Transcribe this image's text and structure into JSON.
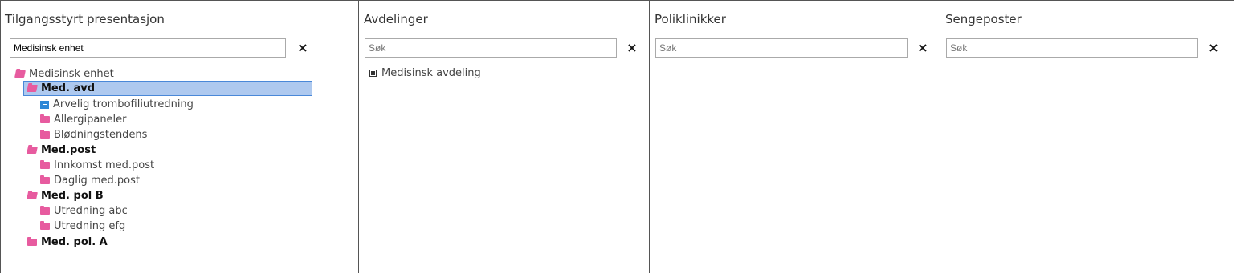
{
  "panel_main": {
    "title": "Tilgangsstyrt presentasjon",
    "search_value": "Medisinsk enhet",
    "clear": "×"
  },
  "tree": {
    "root": {
      "label": "Medisinsk enhet",
      "icon": "folder-open-icon"
    },
    "groups": [
      {
        "label": "Med. avd",
        "icon": "folder-open-icon",
        "selected": true
      },
      {
        "label": "Arvelig trombofiliutredning",
        "icon": "archive-icon"
      },
      {
        "label": "Allergipaneler",
        "icon": "folder-icon"
      },
      {
        "label": "Blødningstendens",
        "icon": "folder-icon"
      },
      {
        "label": "Med.post",
        "icon": "folder-open-icon"
      },
      {
        "label": "Innkomst med.post",
        "icon": "folder-icon"
      },
      {
        "label": "Daglig med.post",
        "icon": "folder-icon"
      },
      {
        "label": "Med. pol B",
        "icon": "folder-open-icon"
      },
      {
        "label": "Utredning abc",
        "icon": "folder-icon"
      },
      {
        "label": "Utredning efg",
        "icon": "folder-icon"
      },
      {
        "label": "Med. pol. A",
        "icon": "folder-icon"
      }
    ]
  },
  "panel_avdelinger": {
    "title": "Avdelinger",
    "search_placeholder": "Søk",
    "clear": "×",
    "items": [
      {
        "label": "Medisinsk avdeling"
      }
    ]
  },
  "panel_poliklinikker": {
    "title": "Poliklinikker",
    "search_placeholder": "Søk",
    "clear": "×"
  },
  "panel_sengeposter": {
    "title": "Sengeposter",
    "search_placeholder": "Søk",
    "clear": "×"
  },
  "colors": {
    "folder": "#e75b9f",
    "archive": "#2f88d6",
    "selection": "#aec9ef",
    "selection_border": "#4a88d8"
  }
}
